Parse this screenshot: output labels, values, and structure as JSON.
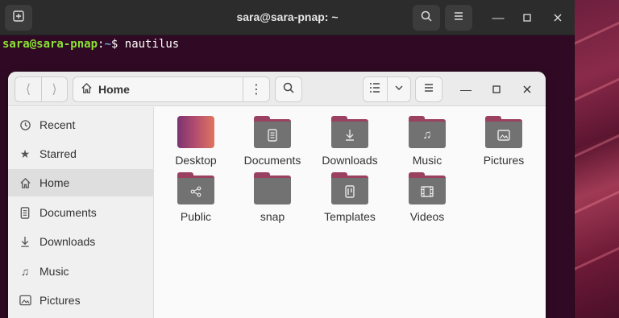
{
  "terminal": {
    "title": "sara@sara-pnap: ~",
    "prompt_user": "sara@sara-pnap",
    "prompt_sep": ":",
    "prompt_path": "~",
    "prompt_symbol": "$",
    "command": "nautilus",
    "new_tab_icon": "new-tab-icon",
    "search_icon": "search-icon",
    "menu_icon": "hamburger-menu-icon"
  },
  "files": {
    "location": "Home",
    "sidebar": [
      {
        "label": "Recent",
        "icon": "clock-icon"
      },
      {
        "label": "Starred",
        "icon": "star-icon"
      },
      {
        "label": "Home",
        "icon": "home-icon",
        "active": true
      },
      {
        "label": "Documents",
        "icon": "document-icon"
      },
      {
        "label": "Downloads",
        "icon": "download-icon"
      },
      {
        "label": "Music",
        "icon": "music-icon"
      },
      {
        "label": "Pictures",
        "icon": "pictures-icon"
      }
    ],
    "items": [
      {
        "label": "Desktop",
        "icon": "desktop-folder-icon"
      },
      {
        "label": "Documents",
        "icon": "documents-folder-icon"
      },
      {
        "label": "Downloads",
        "icon": "downloads-folder-icon"
      },
      {
        "label": "Music",
        "icon": "music-folder-icon"
      },
      {
        "label": "Pictures",
        "icon": "pictures-folder-icon"
      },
      {
        "label": "Public",
        "icon": "public-folder-icon"
      },
      {
        "label": "snap",
        "icon": "folder-icon"
      },
      {
        "label": "Templates",
        "icon": "templates-folder-icon"
      },
      {
        "label": "Videos",
        "icon": "videos-folder-icon"
      }
    ]
  },
  "colors": {
    "terminal_bg": "#300a24",
    "prompt_user": "#8ae234",
    "prompt_path": "#729fcf",
    "folder_tab": "#9a4060",
    "folder_body": "#727272"
  }
}
